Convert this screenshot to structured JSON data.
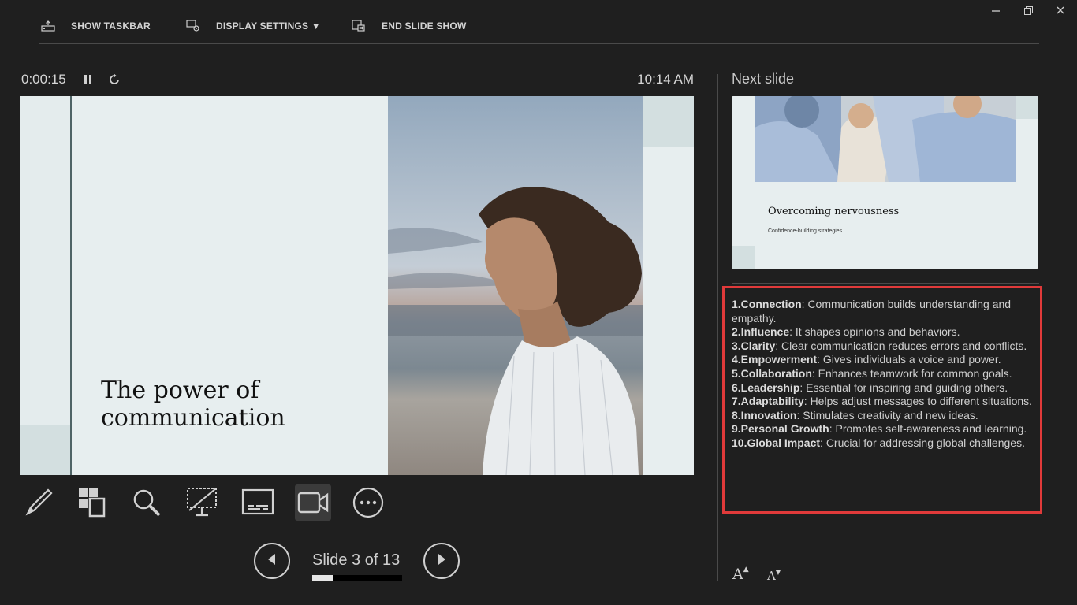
{
  "toolbar": {
    "show_taskbar": "SHOW TASKBAR",
    "display_settings": "DISPLAY SETTINGS ▼",
    "end_slide_show": "END SLIDE SHOW"
  },
  "window_controls": {
    "minimize_icon": "minimize-icon",
    "restore_icon": "restore-icon",
    "close_icon": "close-icon"
  },
  "timer": {
    "elapsed": "0:00:15",
    "clock": "10:14 AM"
  },
  "current_slide": {
    "title_line1": "The power of",
    "title_line2": "communication"
  },
  "tools": [
    "pen-icon",
    "see-all-slides-icon",
    "zoom-icon",
    "black-screen-icon",
    "subtitles-icon",
    "camera-icon",
    "more-options-icon"
  ],
  "navigation": {
    "slide_label": "Slide 3 of 13",
    "progress_fraction": 0.23
  },
  "next_slide": {
    "label": "Next slide",
    "title": "Overcoming nervousness",
    "subtitle": "Confidence-building strategies"
  },
  "notes": [
    {
      "num": "1.",
      "term": "Connection",
      "text": ": Communication builds understanding and empathy."
    },
    {
      "num": "2.",
      "term": "Influence",
      "text": ": It shapes opinions and behaviors."
    },
    {
      "num": "3.",
      "term": "Clarity",
      "text": ": Clear communication reduces errors and conflicts."
    },
    {
      "num": "4.",
      "term": "Empowerment",
      "text": ": Gives individuals a voice and power."
    },
    {
      "num": "5.",
      "term": "Collaboration",
      "text": ": Enhances teamwork for common goals."
    },
    {
      "num": "6.",
      "term": "Leadership",
      "text": ": Essential for inspiring and guiding others."
    },
    {
      "num": "7.",
      "term": "Adaptability",
      "text": ": Helps adjust messages to different situations."
    },
    {
      "num": "8.",
      "term": "Innovation",
      "text": ": Stimulates creativity and new ideas."
    },
    {
      "num": "9.",
      "term": "Personal Growth",
      "text": ": Promotes self-awareness and learning."
    },
    {
      "num": "10.",
      "term": "Global Impact",
      "text": ": Crucial for addressing global challenges."
    }
  ],
  "font_controls": {
    "increase": "A",
    "decrease": "A"
  },
  "colors": {
    "background": "#1f1f1f",
    "highlight_border": "#e03a3a",
    "slide_bg": "#e7eeef"
  }
}
